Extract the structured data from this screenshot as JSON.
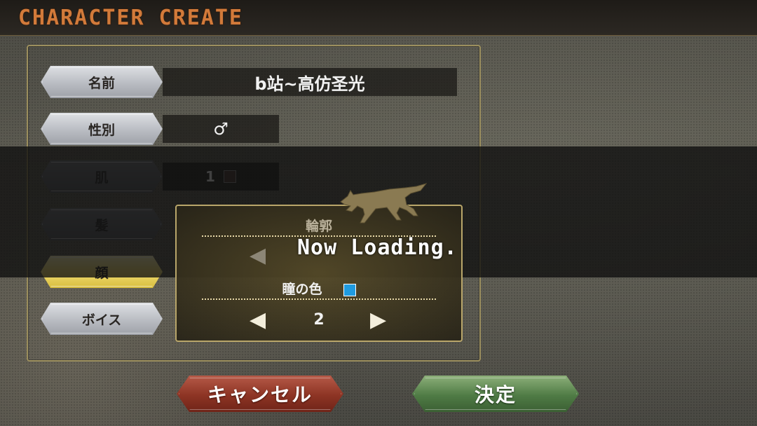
{
  "header": {
    "title": "CHARACTER CREATE"
  },
  "rows": [
    {
      "label": "名前",
      "value": "b站~高仿圣光"
    },
    {
      "label": "性別",
      "value": "♂"
    },
    {
      "label": "肌",
      "value": "1"
    },
    {
      "label": "髪",
      "value": ""
    },
    {
      "label": "顔",
      "value": ""
    },
    {
      "label": "ボイス",
      "value": ""
    }
  ],
  "popup": {
    "field1_label": "輪郭",
    "field2_label": "瞳の色",
    "field2_value": "2",
    "eye_color": "#1f9be0"
  },
  "skin_color": "#4a3a32",
  "loading": {
    "text": "Now Loading."
  },
  "buttons": {
    "cancel": "キャンセル",
    "confirm": "決定"
  }
}
